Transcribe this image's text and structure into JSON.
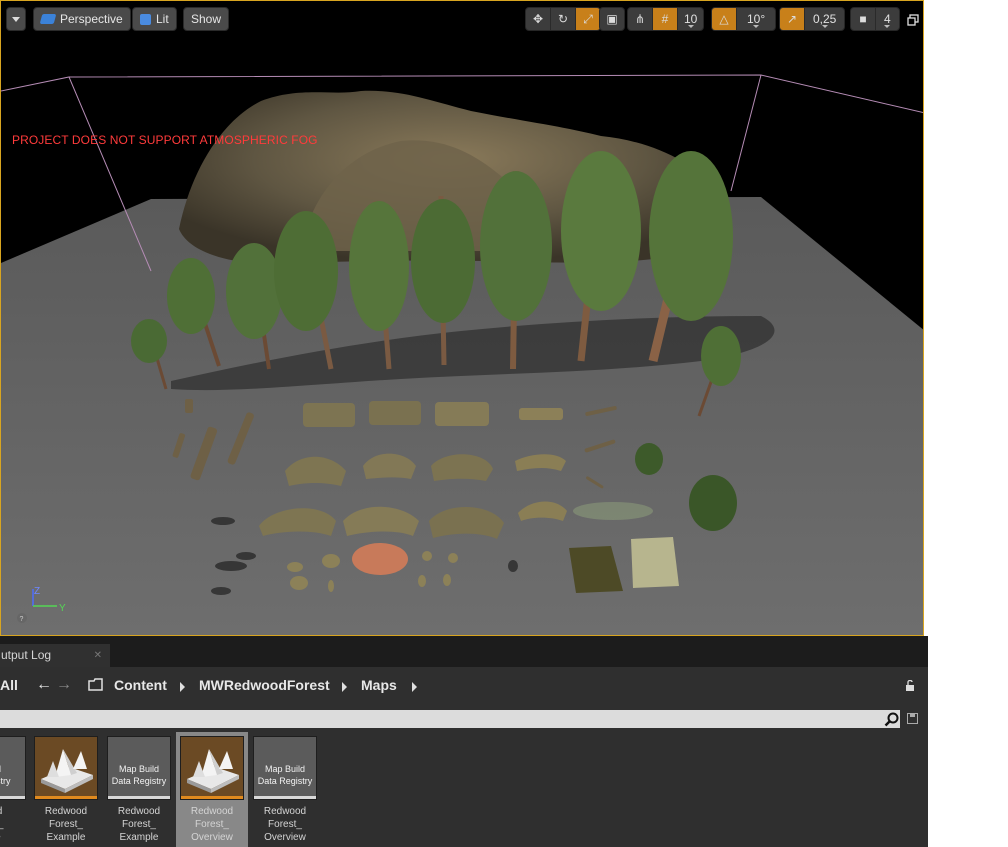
{
  "viewport": {
    "toolbar": {
      "view_mode": "Perspective",
      "lighting": "Lit",
      "show": "Show",
      "grid_snap": "10",
      "rotation_snap": "10°",
      "scale_snap": "0,25",
      "camera_speed": "4"
    },
    "warning": "PROJECT DOES NOT SUPPORT ATMOSPHERIC FOG",
    "colors": {
      "warning": "#ff3b3b",
      "selection_border": "#d8a520",
      "active_snap": "#c8801a"
    }
  },
  "output_tab": {
    "label": "utput Log"
  },
  "path": {
    "all_label": "All",
    "crumbs": [
      "Content",
      "MWRedwoodForest",
      "Maps"
    ]
  },
  "assets": [
    {
      "thumb_label": "uild\nRegistry",
      "name": "ood\nest_\nple",
      "type": "registry",
      "selected": false
    },
    {
      "thumb_label": "",
      "name": "Redwood\nForest_\nExample",
      "type": "map",
      "selected": false
    },
    {
      "thumb_label": "Map Build\nData Registry",
      "name": "Redwood\nForest_\nExample",
      "type": "registry",
      "selected": false
    },
    {
      "thumb_label": "",
      "name": "Redwood\nForest_\nOverview",
      "type": "map",
      "selected": true
    },
    {
      "thumb_label": "Map Build\nData Registry",
      "name": "Redwood\nForest_\nOverview",
      "type": "registry",
      "selected": false
    }
  ]
}
